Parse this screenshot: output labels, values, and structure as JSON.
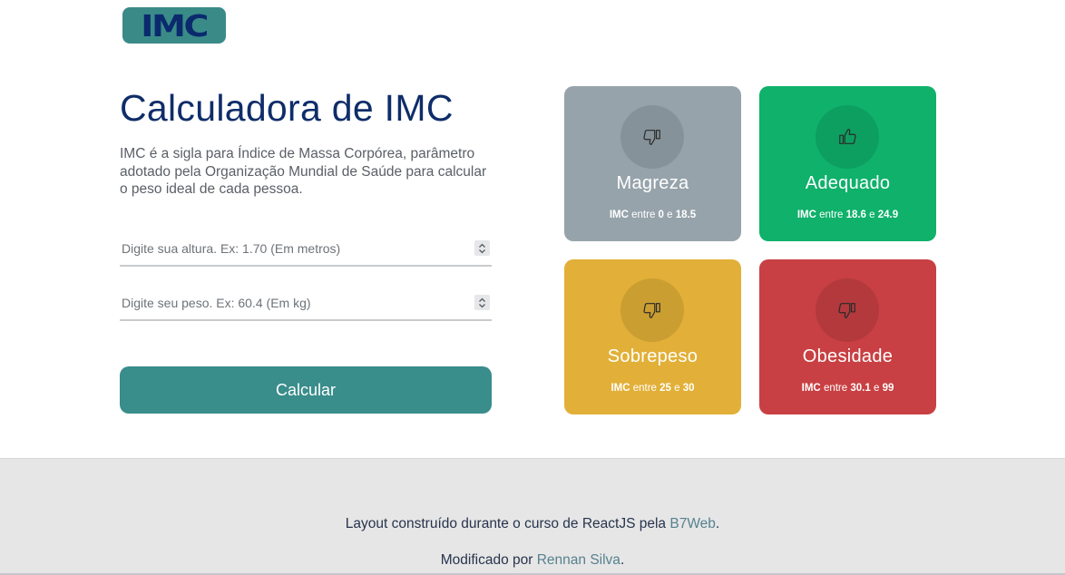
{
  "logo": {
    "text": "IMC"
  },
  "page": {
    "title": "Calculadora de IMC",
    "description": "IMC é a sigla para Índice de Massa Corpórea, parâmetro adotado pela Organização Mundial de Saúde para calcular o peso ideal de cada pessoa."
  },
  "form": {
    "height_placeholder": "Digite sua altura. Ex: 1.70 (Em metros)",
    "weight_placeholder": "Digite seu peso. Ex: 60.4 (Em kg)",
    "calculate_label": "Calcular"
  },
  "cards": [
    {
      "title": "Magreza",
      "label": "IMC",
      "between": "entre",
      "min": "0",
      "and": "e",
      "max": "18.5",
      "color": "#96a3ab",
      "icon": "thumbs-down-icon"
    },
    {
      "title": "Adequado",
      "label": "IMC",
      "between": "entre",
      "min": "18.6",
      "and": "e",
      "max": "24.9",
      "color": "#0fb16b",
      "icon": "thumbs-up-icon"
    },
    {
      "title": "Sobrepeso",
      "label": "IMC",
      "between": "entre",
      "min": "25",
      "and": "e",
      "max": "30",
      "color": "#e2b038",
      "icon": "thumbs-down-icon"
    },
    {
      "title": "Obesidade",
      "label": "IMC",
      "between": "entre",
      "min": "30.1",
      "and": "e",
      "max": "99",
      "color": "#c84043",
      "icon": "thumbs-down-icon"
    }
  ],
  "footer": {
    "line1_text": "Layout construído durante o curso de ReactJS pela ",
    "line1_link": "B7Web",
    "line1_end": ".",
    "line2_text": "Modificado por ",
    "line2_link": "Rennan Silva",
    "line2_end": "."
  },
  "colors": {
    "primary": "#398d8b",
    "title": "#0f2d69",
    "footer_bg": "#e6e6e6",
    "link": "#56818f"
  }
}
